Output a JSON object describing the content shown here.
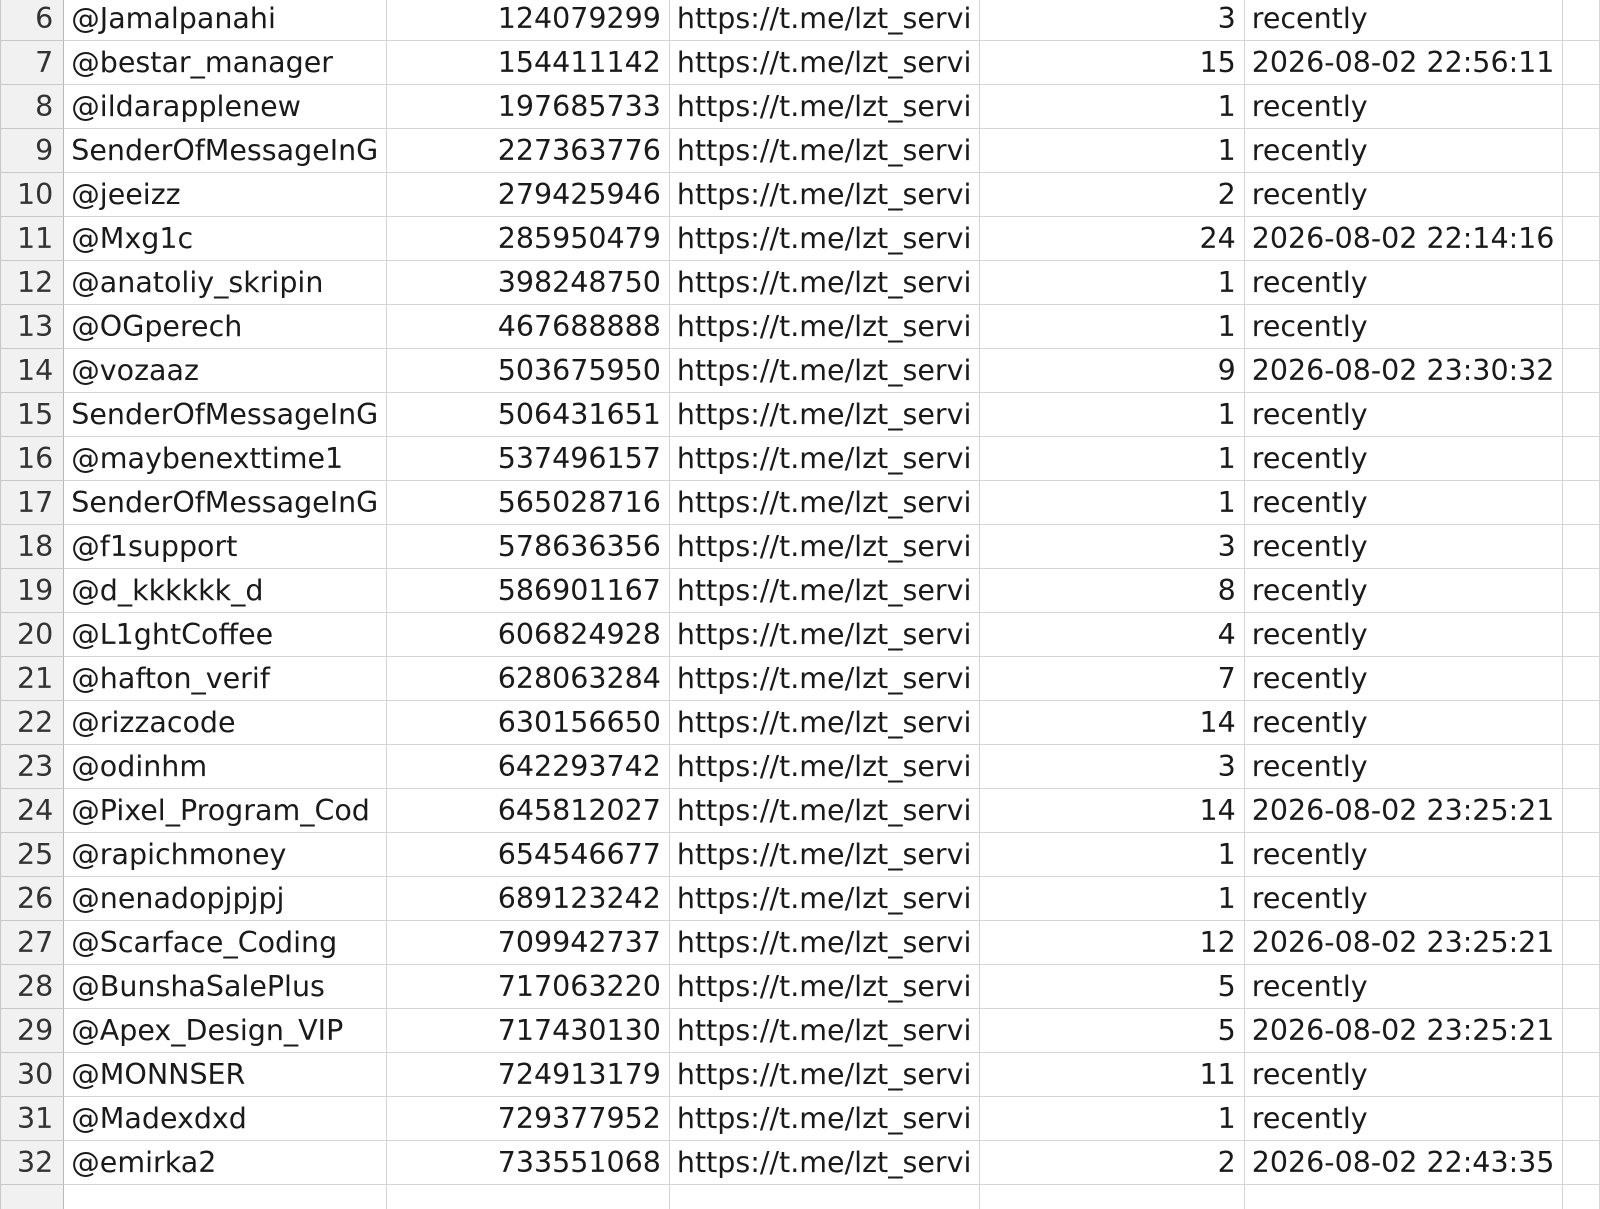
{
  "sheet": {
    "rows": [
      {
        "num": "6",
        "name": "@Jamalpanahi",
        "id": "124079299",
        "link": "https://t.me/lzt_servi",
        "count": "3",
        "seen": "recently"
      },
      {
        "num": "7",
        "name": "@bestar_manager",
        "id": "154411142",
        "link": "https://t.me/lzt_servi",
        "count": "15",
        "seen": "2026-08-02 22:56:11"
      },
      {
        "num": "8",
        "name": "@ildarapplenew",
        "id": "197685733",
        "link": "https://t.me/lzt_servi",
        "count": "1",
        "seen": "recently"
      },
      {
        "num": "9",
        "name": "SenderOfMessageInG",
        "id": "227363776",
        "link": "https://t.me/lzt_servi",
        "count": "1",
        "seen": "recently"
      },
      {
        "num": "10",
        "name": "@jeeizz",
        "id": "279425946",
        "link": "https://t.me/lzt_servi",
        "count": "2",
        "seen": "recently"
      },
      {
        "num": "11",
        "name": "@Mxg1c",
        "id": "285950479",
        "link": "https://t.me/lzt_servi",
        "count": "24",
        "seen": "2026-08-02 22:14:16"
      },
      {
        "num": "12",
        "name": "@anatoliy_skripin",
        "id": "398248750",
        "link": "https://t.me/lzt_servi",
        "count": "1",
        "seen": "recently"
      },
      {
        "num": "13",
        "name": "@OGperech",
        "id": "467688888",
        "link": "https://t.me/lzt_servi",
        "count": "1",
        "seen": "recently"
      },
      {
        "num": "14",
        "name": "@vozaaz",
        "id": "503675950",
        "link": "https://t.me/lzt_servi",
        "count": "9",
        "seen": "2026-08-02 23:30:32"
      },
      {
        "num": "15",
        "name": "SenderOfMessageInG",
        "id": "506431651",
        "link": "https://t.me/lzt_servi",
        "count": "1",
        "seen": "recently"
      },
      {
        "num": "16",
        "name": "@maybenexttime1",
        "id": "537496157",
        "link": "https://t.me/lzt_servi",
        "count": "1",
        "seen": "recently"
      },
      {
        "num": "17",
        "name": "SenderOfMessageInG",
        "id": "565028716",
        "link": "https://t.me/lzt_servi",
        "count": "1",
        "seen": "recently"
      },
      {
        "num": "18",
        "name": "@f1support",
        "id": "578636356",
        "link": "https://t.me/lzt_servi",
        "count": "3",
        "seen": "recently"
      },
      {
        "num": "19",
        "name": "@d_kkkkkk_d",
        "id": "586901167",
        "link": "https://t.me/lzt_servi",
        "count": "8",
        "seen": "recently"
      },
      {
        "num": "20",
        "name": "@L1ghtCoffee",
        "id": "606824928",
        "link": "https://t.me/lzt_servi",
        "count": "4",
        "seen": "recently"
      },
      {
        "num": "21",
        "name": "@hafton_verif",
        "id": "628063284",
        "link": "https://t.me/lzt_servi",
        "count": "7",
        "seen": "recently"
      },
      {
        "num": "22",
        "name": "@rizzacode",
        "id": "630156650",
        "link": "https://t.me/lzt_servi",
        "count": "14",
        "seen": "recently"
      },
      {
        "num": "23",
        "name": "@odinhm",
        "id": "642293742",
        "link": "https://t.me/lzt_servi",
        "count": "3",
        "seen": "recently"
      },
      {
        "num": "24",
        "name": "@Pixel_Program_Cod",
        "id": "645812027",
        "link": "https://t.me/lzt_servi",
        "count": "14",
        "seen": "2026-08-02 23:25:21"
      },
      {
        "num": "25",
        "name": "@rapichmoney",
        "id": "654546677",
        "link": "https://t.me/lzt_servi",
        "count": "1",
        "seen": "recently"
      },
      {
        "num": "26",
        "name": "@nenadopjpjpj",
        "id": "689123242",
        "link": "https://t.me/lzt_servi",
        "count": "1",
        "seen": "recently"
      },
      {
        "num": "27",
        "name": "@Scarface_Coding",
        "id": "709942737",
        "link": "https://t.me/lzt_servi",
        "count": "12",
        "seen": "2026-08-02 23:25:21"
      },
      {
        "num": "28",
        "name": "@BunshaSalePlus",
        "id": "717063220",
        "link": "https://t.me/lzt_servi",
        "count": "5",
        "seen": "recently"
      },
      {
        "num": "29",
        "name": "@Apex_Design_VIP",
        "id": "717430130",
        "link": "https://t.me/lzt_servi",
        "count": "5",
        "seen": "2026-08-02 23:25:21"
      },
      {
        "num": "30",
        "name": "@MONNSER",
        "id": "724913179",
        "link": "https://t.me/lzt_servi",
        "count": "11",
        "seen": "recently"
      },
      {
        "num": "31",
        "name": "@Madexdxd",
        "id": "729377952",
        "link": "https://t.me/lzt_servi",
        "count": "1",
        "seen": "recently"
      },
      {
        "num": "32",
        "name": "@emirka2",
        "id": "733551068",
        "link": "https://t.me/lzt_servi",
        "count": "2",
        "seen": "2026-08-02 22:43:35"
      }
    ]
  }
}
